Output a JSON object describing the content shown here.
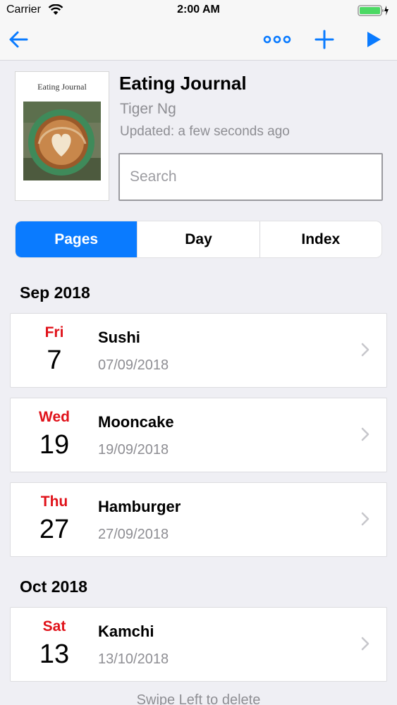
{
  "status_bar": {
    "carrier": "Carrier",
    "time": "2:00 AM"
  },
  "nav": {
    "back_icon": "arrow-left-icon",
    "more_icon": "ellipsis-icon",
    "add_icon": "plus-icon",
    "play_icon": "play-icon",
    "accent_color": "#0a7bff"
  },
  "journal": {
    "cover_title": "Eating Journal",
    "title": "Eating Journal",
    "author": "Tiger Ng",
    "updated": "Updated: a few seconds ago"
  },
  "search": {
    "placeholder": "Search",
    "value": ""
  },
  "tabs": [
    {
      "label": "Pages",
      "selected": true
    },
    {
      "label": "Day",
      "selected": false
    },
    {
      "label": "Index",
      "selected": false
    }
  ],
  "sections": [
    {
      "header": "Sep 2018",
      "entries": [
        {
          "weekday": "Fri",
          "day": "7",
          "title": "Sushi",
          "date": "07/09/2018"
        },
        {
          "weekday": "Wed",
          "day": "19",
          "title": "Mooncake",
          "date": "19/09/2018"
        },
        {
          "weekday": "Thu",
          "day": "27",
          "title": "Hamburger",
          "date": "27/09/2018"
        }
      ]
    },
    {
      "header": "Oct 2018",
      "entries": [
        {
          "weekday": "Sat",
          "day": "13",
          "title": "Kamchi",
          "date": "13/10/2018"
        }
      ]
    }
  ],
  "footer_hint": "Swipe Left to delete",
  "weekday_color": "#e0121a"
}
